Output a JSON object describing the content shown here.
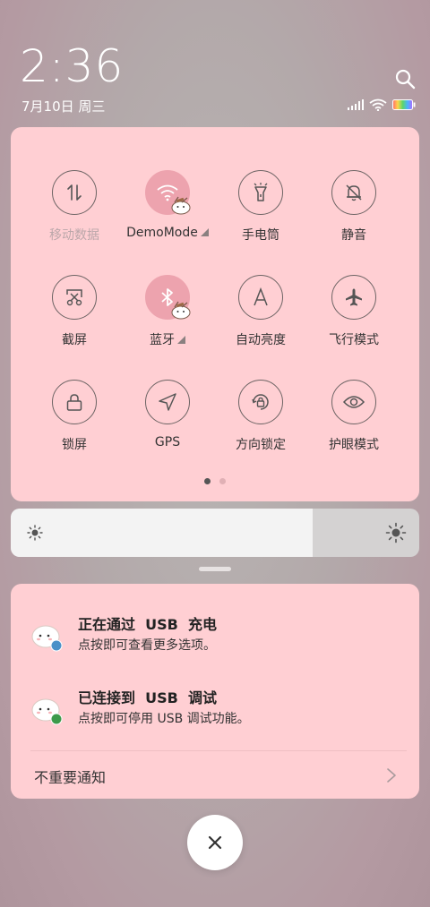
{
  "status": {
    "time": "2:36",
    "date": "7月10日 周三",
    "icons": [
      "search-icon",
      "cellular-signal-icon",
      "wifi-icon",
      "battery-icon"
    ]
  },
  "quick_settings": {
    "tiles": [
      {
        "label": "移动数据",
        "icon": "mobile-data-icon",
        "active": false,
        "dim": true
      },
      {
        "label": "DemoMode",
        "icon": "wifi-icon",
        "active": true,
        "expandable": true
      },
      {
        "label": "手电筒",
        "icon": "flashlight-icon",
        "active": false
      },
      {
        "label": "静音",
        "icon": "mute-bell-icon",
        "active": false
      },
      {
        "label": "截屏",
        "icon": "screenshot-icon",
        "active": false
      },
      {
        "label": "蓝牙",
        "icon": "bluetooth-icon",
        "active": true,
        "expandable": true
      },
      {
        "label": "自动亮度",
        "icon": "auto-brightness-icon",
        "active": false
      },
      {
        "label": "飞行模式",
        "icon": "airplane-icon",
        "active": false
      },
      {
        "label": "锁屏",
        "icon": "lock-icon",
        "active": false
      },
      {
        "label": "GPS",
        "icon": "location-arrow-icon",
        "active": false
      },
      {
        "label": "方向锁定",
        "icon": "rotation-lock-icon",
        "active": false
      },
      {
        "label": "护眼模式",
        "icon": "eye-icon",
        "active": false
      }
    ],
    "page_count": 2,
    "current_page": 1
  },
  "brightness": {
    "level": 0.74
  },
  "notifications": [
    {
      "title": "正在通过  USB  充电",
      "text": "点按即可查看更多选项。",
      "badge_color": "#4a90c8"
    },
    {
      "title": "已连接到  USB  调试",
      "text": "点按即可停用 USB 调试功能。",
      "badge_color": "#3c9a4a"
    }
  ],
  "unimportant_label": "不重要通知",
  "colors": {
    "panel": "#ffcfd3",
    "accent": "#eda3ae"
  }
}
